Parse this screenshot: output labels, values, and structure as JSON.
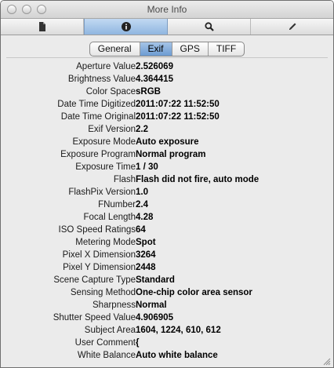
{
  "window": {
    "title": "More Info",
    "toolbar_tabs": [
      {
        "icon": "document-icon",
        "active": false
      },
      {
        "icon": "info-icon",
        "active": true
      },
      {
        "icon": "search-icon",
        "active": false
      },
      {
        "icon": "pencil-icon",
        "active": false
      }
    ],
    "accent_color": "#8fb6e0"
  },
  "segments": {
    "items": [
      "General",
      "Exif",
      "GPS",
      "TIFF"
    ],
    "selected": "Exif"
  },
  "exif": {
    "rows": [
      {
        "label": "Aperture Value",
        "value": "2.526069"
      },
      {
        "label": "Brightness Value",
        "value": "4.364415"
      },
      {
        "label": "Color Space",
        "value": "sRGB"
      },
      {
        "label": "Date Time Digitized",
        "value": "2011:07:22 11:52:50"
      },
      {
        "label": "Date Time Original",
        "value": "2011:07:22 11:52:50"
      },
      {
        "label": "Exif Version",
        "value": "2.2"
      },
      {
        "label": "Exposure Mode",
        "value": "Auto exposure"
      },
      {
        "label": "Exposure Program",
        "value": "Normal program"
      },
      {
        "label": "Exposure Time",
        "value": "1 / 30"
      },
      {
        "label": "Flash",
        "value": "Flash did not fire, auto mode"
      },
      {
        "label": "FlashPix Version",
        "value": "1.0"
      },
      {
        "label": "FNumber",
        "value": "2.4"
      },
      {
        "label": "Focal Length",
        "value": "4.28"
      },
      {
        "label": "ISO Speed Ratings",
        "value": "64"
      },
      {
        "label": "Metering Mode",
        "value": "Spot"
      },
      {
        "label": "Pixel X Dimension",
        "value": "3264"
      },
      {
        "label": "Pixel Y Dimension",
        "value": "2448"
      },
      {
        "label": "Scene Capture Type",
        "value": "Standard"
      },
      {
        "label": "Sensing Method",
        "value": "One-chip color area sensor"
      },
      {
        "label": "Sharpness",
        "value": "Normal"
      },
      {
        "label": "Shutter Speed Value",
        "value": "4.906905"
      },
      {
        "label": "Subject Area",
        "value": "1604, 1224, 610, 612"
      },
      {
        "label": "User Comment",
        "value": "{"
      },
      {
        "label": "White Balance",
        "value": "Auto white balance"
      }
    ]
  }
}
